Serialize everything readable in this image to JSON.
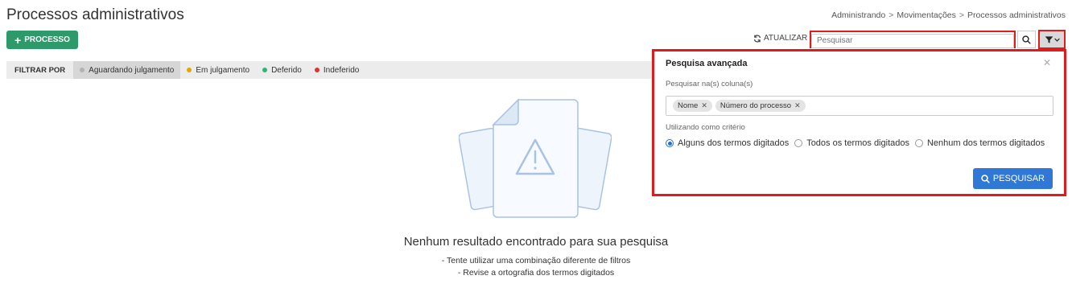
{
  "header": {
    "title": "Processos administrativos",
    "breadcrumb": [
      "Administrando",
      "Movimentações",
      "Processos administrativos"
    ],
    "new_button": "PROCESSO"
  },
  "toolbar": {
    "refresh_label": "ATUALIZAR",
    "search_placeholder": "Pesquisar"
  },
  "filter_bar": {
    "label": "FILTRAR POR",
    "chips": [
      {
        "label": "Aguardando julgamento",
        "color": "#b3b3b3",
        "active": true
      },
      {
        "label": "Em julgamento",
        "color": "#e0a800",
        "active": false
      },
      {
        "label": "Deferido",
        "color": "#2bb673",
        "active": false
      },
      {
        "label": "Indeferido",
        "color": "#e03131",
        "active": false
      }
    ]
  },
  "empty_state": {
    "title": "Nenhum resultado encontrado para sua pesquisa",
    "tips": [
      "- Tente utilizar uma combinação diferente de filtros",
      "- Revise a ortografia dos termos digitados"
    ]
  },
  "advanced_search": {
    "title": "Pesquisa avançada",
    "columns_label": "Pesquisar na(s) coluna(s)",
    "tags": [
      "Nome",
      "Número do processo"
    ],
    "criteria_label": "Utilizando como critério",
    "options": [
      {
        "label": "Alguns dos termos digitados",
        "checked": true
      },
      {
        "label": "Todos os termos digitados",
        "checked": false
      },
      {
        "label": "Nenhum dos termos digitados",
        "checked": false
      }
    ],
    "submit_label": "PESQUISAR"
  },
  "colors": {
    "primary_green": "#2e9a6a",
    "primary_blue": "#2f78d6",
    "highlight_red": "#e01b1b"
  }
}
